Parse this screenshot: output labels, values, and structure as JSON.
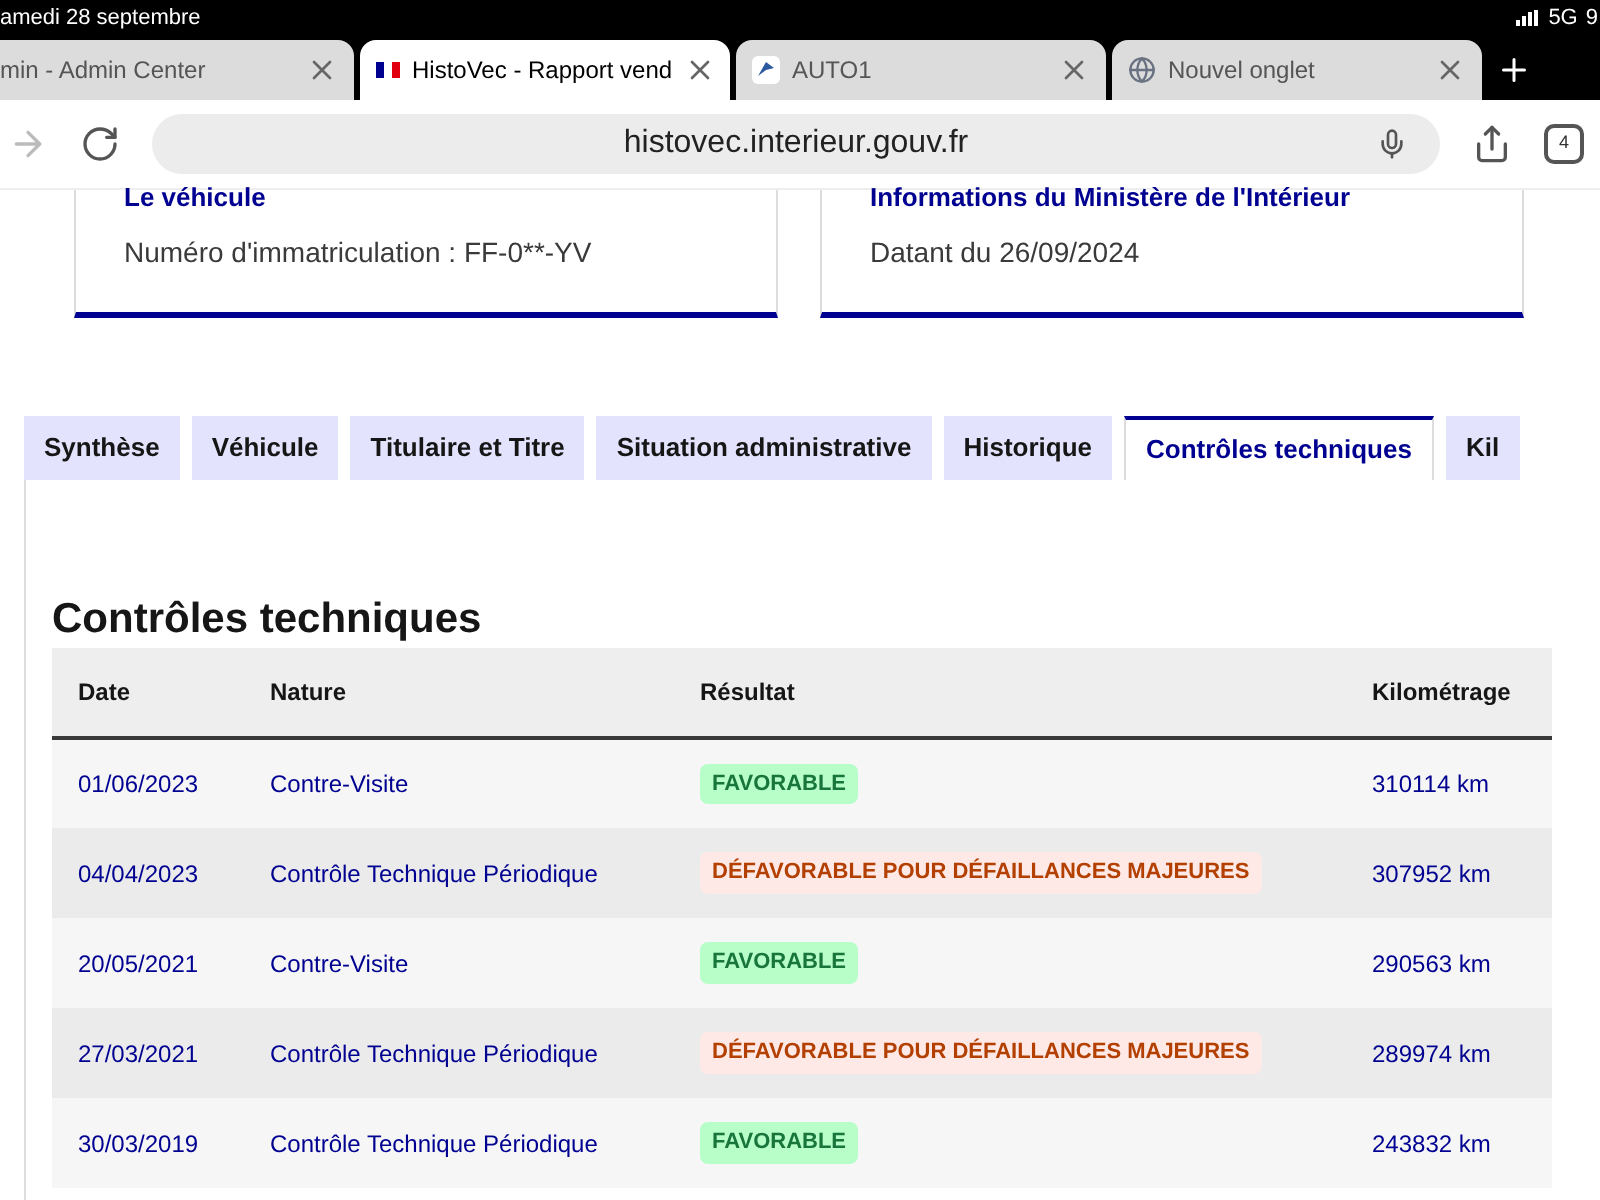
{
  "status_bar": {
    "date": "amedi 28 septembre",
    "network": "5G",
    "battery": "9"
  },
  "browser_tabs": [
    {
      "title": "min - Admin Center",
      "selected": false,
      "kind": "plain"
    },
    {
      "title": "HistoVec - Rapport vend",
      "selected": true,
      "kind": "flag"
    },
    {
      "title": "AUTO1",
      "selected": false,
      "kind": "logo"
    },
    {
      "title": "Nouvel onglet",
      "selected": false,
      "kind": "globe"
    }
  ],
  "address_bar": {
    "url": "histovec.interieur.gouv.fr",
    "tab_count": "4"
  },
  "cards": [
    {
      "title": "Le véhicule",
      "text": "Numéro d'immatriculation : FF-0**-YV"
    },
    {
      "title": "Informations du Ministère de l'Intérieur",
      "text": "Datant du 26/09/2024"
    }
  ],
  "tabs": [
    {
      "label": "Synthèse",
      "selected": false
    },
    {
      "label": "Véhicule",
      "selected": false
    },
    {
      "label": "Titulaire et Titre",
      "selected": false
    },
    {
      "label": "Situation administrative",
      "selected": false
    },
    {
      "label": "Historique",
      "selected": false
    },
    {
      "label": "Contrôles techniques",
      "selected": true
    },
    {
      "label": "Kil",
      "selected": false
    }
  ],
  "section_title": "Contrôles techniques",
  "table": {
    "columns": [
      "Date",
      "Nature",
      "Résultat",
      "Kilométrage"
    ],
    "rows": [
      {
        "date": "01/06/2023",
        "nature": "Contre-Visite",
        "result": {
          "text": "FAVORABLE",
          "kind": "favorable"
        },
        "mileage": "310114 km"
      },
      {
        "date": "04/04/2023",
        "nature": "Contrôle Technique Périodique",
        "result": {
          "text": "DÉFAVORABLE POUR DÉFAILLANCES MAJEURES",
          "kind": "unfavorable"
        },
        "mileage": "307952 km"
      },
      {
        "date": "20/05/2021",
        "nature": "Contre-Visite",
        "result": {
          "text": "FAVORABLE",
          "kind": "favorable"
        },
        "mileage": "290563 km"
      },
      {
        "date": "27/03/2021",
        "nature": "Contrôle Technique Périodique",
        "result": {
          "text": "DÉFAVORABLE POUR DÉFAILLANCES MAJEURES",
          "kind": "unfavorable"
        },
        "mileage": "289974 km"
      },
      {
        "date": "30/03/2019",
        "nature": "Contrôle Technique Périodique",
        "result": {
          "text": "FAVORABLE",
          "kind": "favorable"
        },
        "mileage": "243832 km"
      }
    ]
  }
}
